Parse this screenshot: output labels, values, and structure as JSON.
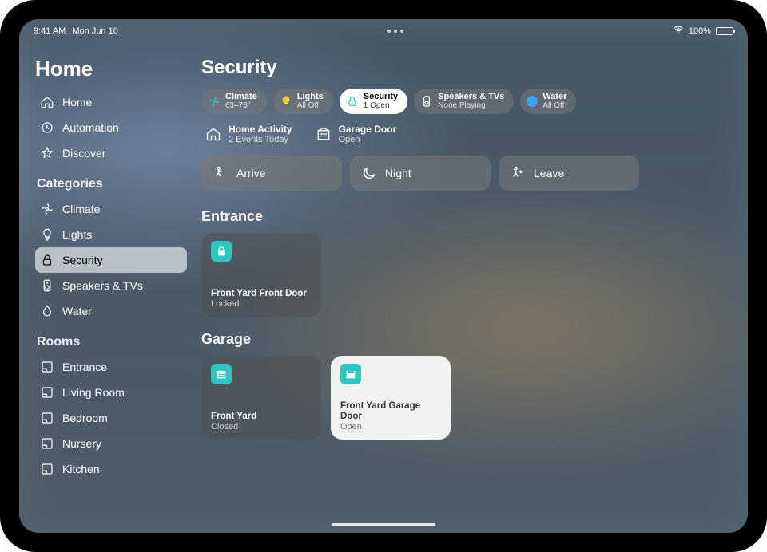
{
  "statusbar": {
    "time": "9:41 AM",
    "date": "Mon Jun 10",
    "battery": "100%"
  },
  "app_title": "Home",
  "sidebar": {
    "top": [
      {
        "label": "Home"
      },
      {
        "label": "Automation"
      },
      {
        "label": "Discover"
      }
    ],
    "categories_title": "Categories",
    "categories": [
      {
        "label": "Climate"
      },
      {
        "label": "Lights"
      },
      {
        "label": "Security",
        "active": true
      },
      {
        "label": "Speakers & TVs"
      },
      {
        "label": "Water"
      }
    ],
    "rooms_title": "Rooms",
    "rooms": [
      {
        "label": "Entrance"
      },
      {
        "label": "Living Room"
      },
      {
        "label": "Bedroom"
      },
      {
        "label": "Nursery"
      },
      {
        "label": "Kitchen"
      }
    ]
  },
  "page_title": "Security",
  "chips": [
    {
      "title": "Climate",
      "sub": "63–73°",
      "color": "#2ec6c0"
    },
    {
      "title": "Lights",
      "sub": "All Off",
      "color": "#ffcc33"
    },
    {
      "title": "Security",
      "sub": "1 Open",
      "color": "#2ec6c0",
      "active": true
    },
    {
      "title": "Speakers & TVs",
      "sub": "None Playing",
      "color": null
    },
    {
      "title": "Water",
      "sub": "All Off",
      "color": "#3aa3ff"
    }
  ],
  "info": [
    {
      "title": "Home Activity",
      "sub": "2 Events Today"
    },
    {
      "title": "Garage Door",
      "sub": "Open"
    }
  ],
  "scenes": [
    {
      "label": "Arrive"
    },
    {
      "label": "Night"
    },
    {
      "label": "Leave"
    }
  ],
  "sections": [
    {
      "title": "Entrance",
      "tiles": [
        {
          "name": "Front Yard Front Door",
          "status": "Locked",
          "style": "dark",
          "icon": "lock",
          "icon_bg": "#2ec6c0"
        }
      ]
    },
    {
      "title": "Garage",
      "tiles": [
        {
          "name": "Front Yard",
          "status": "Closed",
          "style": "dark",
          "icon": "garage",
          "icon_bg": "#2ec6c0"
        },
        {
          "name": "Front Yard Garage Door",
          "status": "Open",
          "style": "light",
          "icon": "garage",
          "icon_bg": "#2ec6c0"
        }
      ]
    }
  ]
}
